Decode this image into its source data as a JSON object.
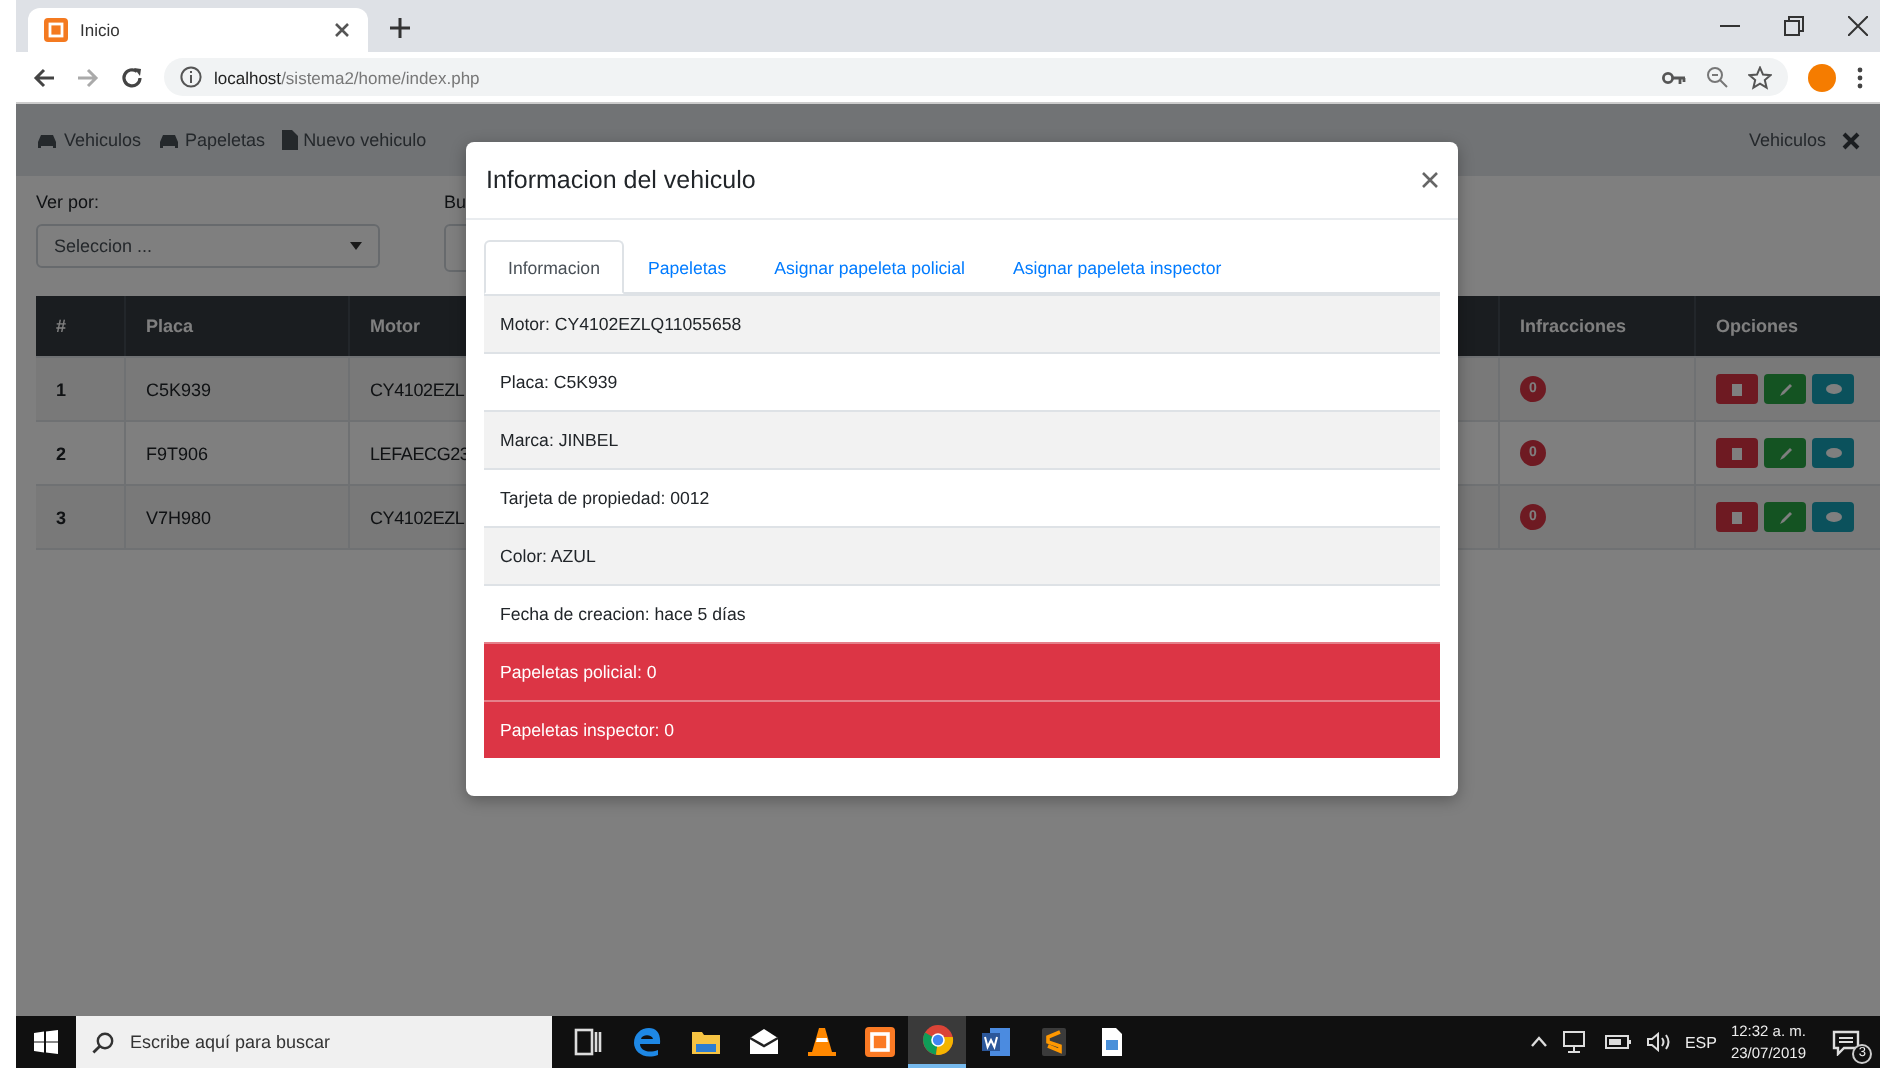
{
  "browser": {
    "tab_title": "Inicio",
    "url_host": "localhost",
    "url_path": "/sistema2/home/index.php"
  },
  "navbar": {
    "items": [
      {
        "label": "Vehiculos",
        "kind": "car"
      },
      {
        "label": "Papeletas",
        "kind": "car"
      },
      {
        "label": "Nuevo vehiculo",
        "kind": "file"
      }
    ],
    "right_label": "Vehiculos"
  },
  "filters": {
    "ver_por_label": "Ver por:",
    "select_value": "Seleccion ...",
    "search_label": "Bu"
  },
  "table": {
    "columns": [
      "#",
      "Placa",
      "Motor",
      "Infracciones",
      "Opciones"
    ],
    "rows": [
      {
        "number": "1",
        "placa": "C5K939",
        "motor": "CY4102EZL",
        "infracciones": "0"
      },
      {
        "number": "2",
        "placa": "F9T906",
        "motor": "LEFAECG23",
        "infracciones": "0"
      },
      {
        "number": "3",
        "placa": "V7H980",
        "motor": "CY4102EZL",
        "infracciones": "0"
      }
    ]
  },
  "modal": {
    "title": "Informacion del vehiculo",
    "tabs": [
      {
        "label": "Informacion",
        "selected": true
      },
      {
        "label": "Papeletas",
        "selected": false
      },
      {
        "label": "Asignar papeleta policial",
        "selected": false
      },
      {
        "label": "Asignar papeleta inspector",
        "selected": false
      }
    ],
    "rows": [
      {
        "text": "Motor: CY4102EZLQ11055658",
        "kind": "normal"
      },
      {
        "text": "Placa: C5K939",
        "kind": "normal"
      },
      {
        "text": "Marca: JINBEL",
        "kind": "normal"
      },
      {
        "text": "Tarjeta de propiedad: 0012",
        "kind": "normal"
      },
      {
        "text": "Color: AZUL",
        "kind": "normal"
      },
      {
        "text": "Fecha de creacion: hace 5 días",
        "kind": "normal"
      },
      {
        "text": "Papeletas policial: 0",
        "kind": "danger"
      },
      {
        "text": "Papeletas inspector: 0",
        "kind": "danger"
      }
    ]
  },
  "taskbar": {
    "search_placeholder": "Escribe aquí para buscar",
    "apps": [
      {
        "kind": "taskview",
        "selected": false
      },
      {
        "kind": "edge",
        "selected": false
      },
      {
        "kind": "folder",
        "selected": false
      },
      {
        "kind": "mail",
        "selected": false
      },
      {
        "kind": "cone",
        "selected": false
      },
      {
        "kind": "xampp",
        "selected": false
      },
      {
        "kind": "chrome",
        "selected": true
      },
      {
        "kind": "word",
        "selected": false
      },
      {
        "kind": "sublime",
        "selected": false
      },
      {
        "kind": "photos",
        "selected": false
      }
    ],
    "language": "ESP",
    "time": "12:32 a. m.",
    "date": "23/07/2019",
    "notifications": "3"
  }
}
